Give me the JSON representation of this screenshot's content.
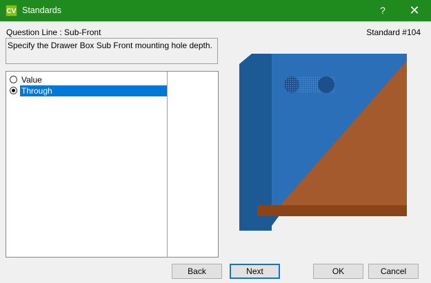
{
  "window": {
    "icon_text": "CV",
    "title": "Standards",
    "help_label": "?",
    "close_label": "✕"
  },
  "header": {
    "question_line": "Question Line : Sub-Front",
    "standard": "Standard #104"
  },
  "description": "Specify the Drawer Box Sub Front mounting hole depth.",
  "options": [
    {
      "label": "Value",
      "selected": false
    },
    {
      "label": "Through",
      "selected": true
    }
  ],
  "preview": {
    "icon": "drawer-sub-front-through-hole-illustration",
    "colors": {
      "front_panel": "#2a6fb7",
      "side_panel": "#1b5a94",
      "wood": "#a45a2c",
      "shelf": "#8a4419",
      "hole": "#1d4f8a"
    }
  },
  "buttons": {
    "back": "Back",
    "next": "Next",
    "ok": "OK",
    "cancel": "Cancel"
  }
}
